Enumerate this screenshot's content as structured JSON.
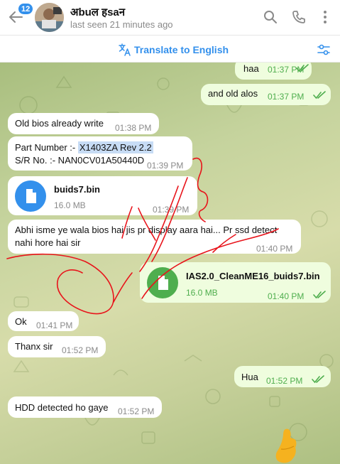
{
  "header": {
    "unread_count": "12",
    "title": "अbuल हsaन",
    "status": "last seen 21 minutes ago"
  },
  "translate": {
    "label": "Translate to English"
  },
  "messages": {
    "m1": {
      "text": "haa",
      "time": "01:37 PM"
    },
    "m2": {
      "text": "and old alos",
      "time": "01:37 PM"
    },
    "m3": {
      "text": "Old bios already write",
      "time": "01:38 PM"
    },
    "m4": {
      "line1_prefix": "Part Number :- ",
      "line1_highlight": "X1403ZA Rev 2.2",
      "line2": "S/R No. :- NAN0CV01A50440D",
      "time": "01:39 PM"
    },
    "m5": {
      "file_name": "buids7.bin",
      "file_size": "16.0 MB",
      "time": "01:39 PM"
    },
    "m6": {
      "text": "Abhi isme ye wala bios hai jis pr display aara hai... Pr ssd detect nahi hore hai sir",
      "time": "01:40 PM"
    },
    "m7": {
      "file_name": "IAS2.0_CleanME16_buids7.bin",
      "file_size": "16.0 MB",
      "time": "01:40 PM"
    },
    "m8": {
      "text": "Ok",
      "time": "01:41 PM"
    },
    "m9": {
      "text": "Thanx sir",
      "time": "01:52 PM"
    },
    "m10": {
      "text": "Hua",
      "time": "01:52 PM"
    },
    "m11": {
      "text": "HDD detected ho gaye",
      "time": "01:52 PM"
    }
  },
  "colors": {
    "accent": "#3390ec",
    "outgoing_bubble": "#effdde",
    "read_ticks": "#4fae4e",
    "annotation": "#e8141b"
  }
}
